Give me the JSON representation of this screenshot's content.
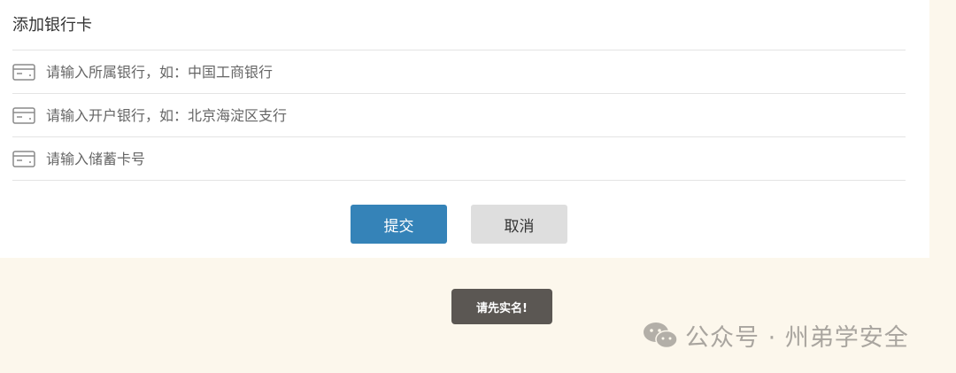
{
  "form": {
    "title": "添加银行卡",
    "fields": [
      {
        "placeholder": "请输入所属银行，如：中国工商银行",
        "value": "",
        "icon": "bank-card-icon"
      },
      {
        "placeholder": "请输入开户银行，如：北京海淀区支行",
        "value": "",
        "icon": "bank-card-icon"
      },
      {
        "placeholder": "请输入储蓄卡号",
        "value": "",
        "icon": "bank-card-icon"
      }
    ],
    "submit_label": "提交",
    "cancel_label": "取消"
  },
  "toast": {
    "message": "请先实名!"
  },
  "watermark": {
    "text": "公众号 · 州弟学安全",
    "icon": "wechat-icon"
  },
  "colors": {
    "page_background": "#fcf7ec",
    "submit_button": "#3583b8",
    "cancel_button": "#dedede",
    "toast_background": "#5b5753"
  }
}
